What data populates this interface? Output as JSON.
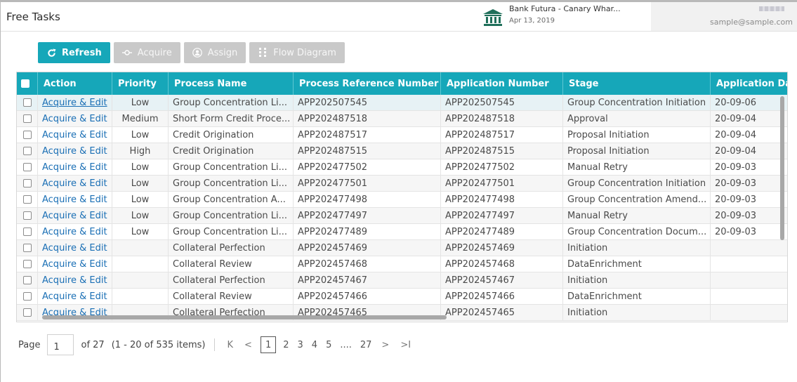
{
  "header": {
    "title": "Free Tasks",
    "bank_name": "Bank Futura - Canary Whar...",
    "date": "Apr 13, 2019",
    "user_email": "sample@sample.com"
  },
  "toolbar": {
    "refresh": "Refresh",
    "acquire": "Acquire",
    "assign": "Assign",
    "flow_diagram": "Flow Diagram"
  },
  "colors": {
    "accent": "#16a7b9",
    "link": "#1a6fb5",
    "disabled": "#c9c9c9"
  },
  "table": {
    "columns": [
      "Action",
      "Priority",
      "Process Name",
      "Process Reference Number",
      "Application Number",
      "Stage",
      "Application Da"
    ],
    "rows": [
      {
        "action": "Acquire & Edit",
        "priority": "Low",
        "process": "Group Concentration Li...",
        "ref": "APP202507545",
        "app": "APP202507545",
        "stage": "Group Concentration Initiation",
        "date": "20-09-06"
      },
      {
        "action": "Acquire & Edit",
        "priority": "Medium",
        "process": "Short Form Credit Proce...",
        "ref": "APP202487518",
        "app": "APP202487518",
        "stage": "Approval",
        "date": "20-09-04"
      },
      {
        "action": "Acquire & Edit",
        "priority": "Low",
        "process": "Credit Origination",
        "ref": "APP202487517",
        "app": "APP202487517",
        "stage": "Proposal Initiation",
        "date": "20-09-04"
      },
      {
        "action": "Acquire & Edit",
        "priority": "High",
        "process": "Credit Origination",
        "ref": "APP202487515",
        "app": "APP202487515",
        "stage": "Proposal Initiation",
        "date": "20-09-04"
      },
      {
        "action": "Acquire & Edit",
        "priority": "Low",
        "process": "Group Concentration Li...",
        "ref": "APP202477502",
        "app": "APP202477502",
        "stage": "Manual Retry",
        "date": "20-09-03"
      },
      {
        "action": "Acquire & Edit",
        "priority": "Low",
        "process": "Group Concentration Li...",
        "ref": "APP202477501",
        "app": "APP202477501",
        "stage": "Group Concentration Initiation",
        "date": "20-09-03"
      },
      {
        "action": "Acquire & Edit",
        "priority": "Low",
        "process": "Group Concentration A...",
        "ref": "APP202477498",
        "app": "APP202477498",
        "stage": "Group Concentration Amend...",
        "date": "20-09-03"
      },
      {
        "action": "Acquire & Edit",
        "priority": "Low",
        "process": "Group Concentration Li...",
        "ref": "APP202477497",
        "app": "APP202477497",
        "stage": "Manual Retry",
        "date": "20-09-03"
      },
      {
        "action": "Acquire & Edit",
        "priority": "Low",
        "process": "Group Concentration Li...",
        "ref": "APP202477489",
        "app": "APP202477489",
        "stage": "Group Concentration Docum...",
        "date": "20-09-03"
      },
      {
        "action": "Acquire & Edit",
        "priority": "",
        "process": "Collateral Perfection",
        "ref": "APP202457469",
        "app": "APP202457469",
        "stage": "Initiation",
        "date": ""
      },
      {
        "action": "Acquire & Edit",
        "priority": "",
        "process": "Collateral Review",
        "ref": "APP202457468",
        "app": "APP202457468",
        "stage": "DataEnrichment",
        "date": ""
      },
      {
        "action": "Acquire & Edit",
        "priority": "",
        "process": "Collateral Perfection",
        "ref": "APP202457467",
        "app": "APP202457467",
        "stage": "Initiation",
        "date": ""
      },
      {
        "action": "Acquire & Edit",
        "priority": "",
        "process": "Collateral Review",
        "ref": "APP202457466",
        "app": "APP202457466",
        "stage": "DataEnrichment",
        "date": ""
      },
      {
        "action": "Acquire & Edit",
        "priority": "",
        "process": "Collateral Perfection",
        "ref": "APP202457465",
        "app": "APP202457465",
        "stage": "Initiation",
        "date": ""
      }
    ]
  },
  "pagination": {
    "page_label": "Page",
    "current_page": "1",
    "of_label": "of 27",
    "items_label": "(1 - 20 of 535 items)",
    "first": "K",
    "prev": "<",
    "pages": [
      "1",
      "2",
      "3",
      "4",
      "5",
      "....",
      "27"
    ],
    "next": ">",
    "last": ">I"
  }
}
